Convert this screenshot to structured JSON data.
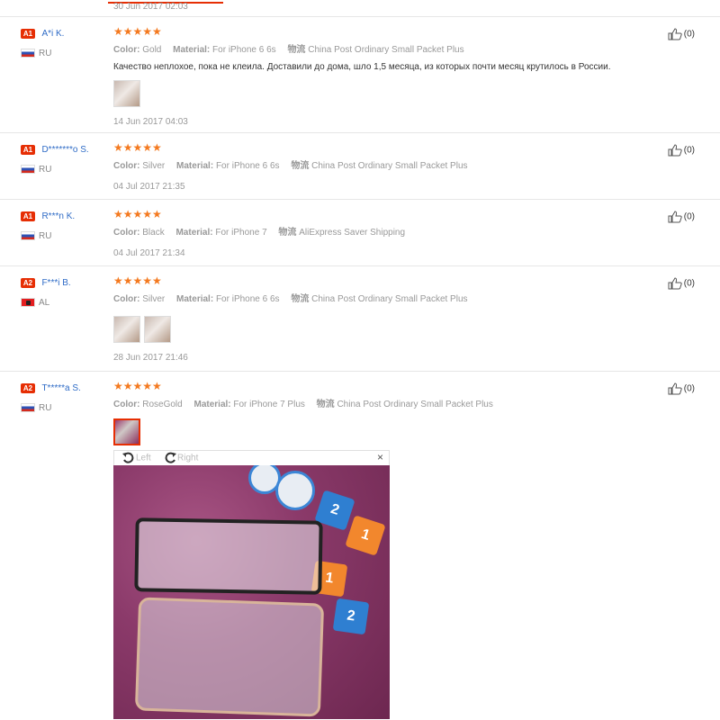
{
  "top": {
    "date": "30 Jun 2017 02:03"
  },
  "reviews": [
    {
      "level": "A1",
      "user": "A*i K.",
      "country": "RU",
      "flag": "ru",
      "stars": "★★★★★",
      "color_label": "Color:",
      "color": "Gold",
      "material_label": "Material:",
      "material": "For iPhone 6 6s",
      "shipping_label": "物流",
      "shipping": "China Post Ordinary Small Packet Plus",
      "comment": "Качество неплохое, пока не клеила. Доставили до дома, шло 1,5 месяца, из которых почти месяц крутилось в России.",
      "date": "14 Jun 2017 04:03",
      "helpful": "(0)"
    },
    {
      "level": "A1",
      "user": "D*******o S.",
      "country": "RU",
      "flag": "ru",
      "stars": "★★★★★",
      "color_label": "Color:",
      "color": "Silver",
      "material_label": "Material:",
      "material": "For iPhone 6 6s",
      "shipping_label": "物流",
      "shipping": "China Post Ordinary Small Packet Plus",
      "comment": "",
      "date": "04 Jul 2017 21:35",
      "helpful": "(0)"
    },
    {
      "level": "A1",
      "user": "R***n K.",
      "country": "RU",
      "flag": "ru",
      "stars": "★★★★★",
      "color_label": "Color:",
      "color": "Black",
      "material_label": "Material:",
      "material": "For iPhone 7",
      "shipping_label": "物流",
      "shipping": "AliExpress Saver Shipping",
      "comment": "",
      "date": "04 Jul 2017 21:34",
      "helpful": "(0)"
    },
    {
      "level": "A2",
      "user": "F***i B.",
      "country": "AL",
      "flag": "al",
      "stars": "★★★★★",
      "color_label": "Color:",
      "color": "Silver",
      "material_label": "Material:",
      "material": "For iPhone 6 6s",
      "shipping_label": "物流",
      "shipping": "China Post Ordinary Small Packet Plus",
      "comment": "",
      "date": "28 Jun 2017 21:46",
      "helpful": "(0)"
    },
    {
      "level": "A2",
      "user": "T*****a S.",
      "country": "RU",
      "flag": "ru",
      "stars": "★★★★★",
      "color_label": "Color:",
      "color": "RoseGold",
      "material_label": "Material:",
      "material": "For iPhone 7 Plus",
      "shipping_label": "物流",
      "shipping": "China Post Ordinary Small Packet Plus",
      "comment": "",
      "date": "",
      "helpful": "(0)"
    }
  ],
  "viewer": {
    "left_label": "Left",
    "right_label": "Right",
    "close": "×",
    "cards": [
      "2",
      "1",
      "1",
      "2"
    ]
  }
}
